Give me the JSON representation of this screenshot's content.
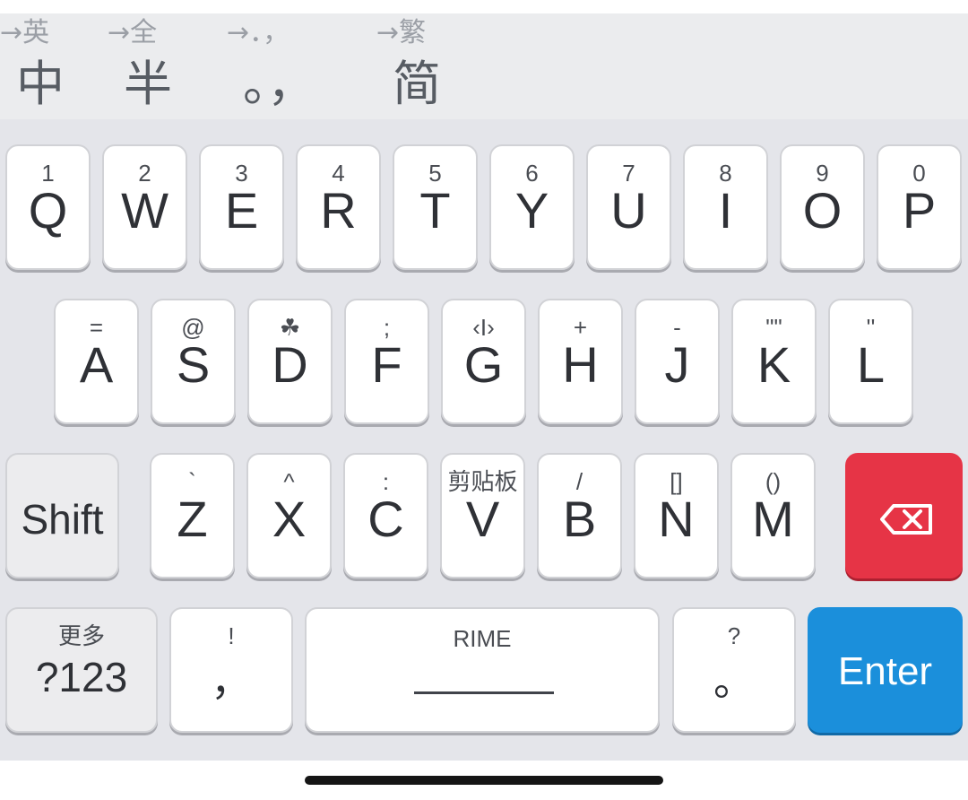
{
  "toolbar": {
    "items": [
      {
        "hint": "→英",
        "main": "中"
      },
      {
        "hint": "→全",
        "main": "半"
      },
      {
        "hint": "→．，",
        "main": "。，"
      },
      {
        "hint": "→繁",
        "main": "简"
      }
    ]
  },
  "keyboard": {
    "rows": [
      [
        {
          "hint": "1",
          "label": "Q"
        },
        {
          "hint": "2",
          "label": "W"
        },
        {
          "hint": "3",
          "label": "E"
        },
        {
          "hint": "4",
          "label": "R"
        },
        {
          "hint": "5",
          "label": "T"
        },
        {
          "hint": "6",
          "label": "Y"
        },
        {
          "hint": "7",
          "label": "U"
        },
        {
          "hint": "8",
          "label": "I"
        },
        {
          "hint": "9",
          "label": "O"
        },
        {
          "hint": "0",
          "label": "P"
        }
      ],
      [
        {
          "hint": "=",
          "label": "A"
        },
        {
          "hint": "@",
          "label": "S"
        },
        {
          "hint": "☘",
          "label": "D"
        },
        {
          "hint": ";",
          "label": "F"
        },
        {
          "hint": "‹I›",
          "label": "G"
        },
        {
          "hint": "+",
          "label": "H"
        },
        {
          "hint": "-",
          "label": "J"
        },
        {
          "hint": "\"\"",
          "label": "K"
        },
        {
          "hint": "''",
          "label": "L"
        }
      ],
      [
        {
          "hint": "`",
          "label": "Z"
        },
        {
          "hint": "^",
          "label": "X"
        },
        {
          "hint": ":",
          "label": "C"
        },
        {
          "hint": "剪贴板",
          "label": "V"
        },
        {
          "hint": "/",
          "label": "B"
        },
        {
          "hint": "[]",
          "label": "N"
        },
        {
          "hint": "()",
          "label": "M"
        }
      ]
    ],
    "shift_label": "Shift",
    "delete_icon": "backspace-icon",
    "more_hint": "更多",
    "symbols_label": "?123",
    "comma_hint": "!",
    "comma_label": "，",
    "space_hint": "RIME",
    "period_hint": "?",
    "period_label": "。",
    "enter_label": "Enter"
  },
  "colors": {
    "delete": "#e63446",
    "enter": "#1b8fdb",
    "keyboard_background": "#e4e5ea",
    "toolbar_background": "#ebecee"
  }
}
